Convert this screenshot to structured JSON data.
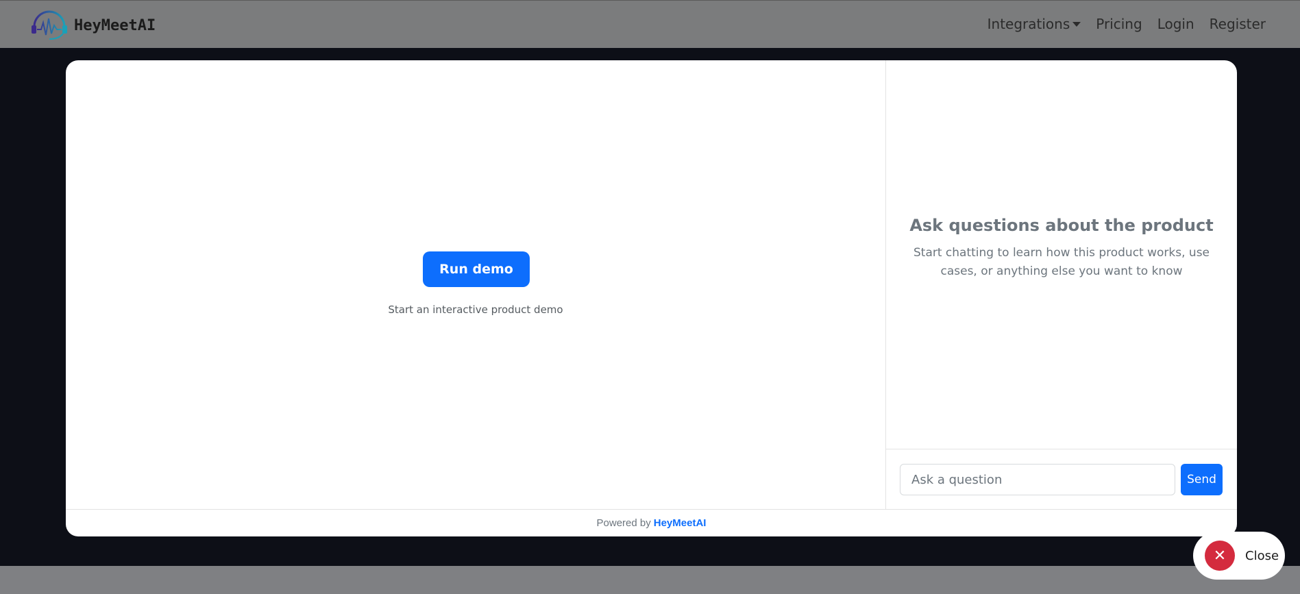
{
  "navbar": {
    "brand_name": "HeyMeetAI",
    "links": {
      "integrations": "Integrations",
      "pricing": "Pricing",
      "login": "Login",
      "register": "Register"
    }
  },
  "demo": {
    "run_button": "Run demo",
    "caption": "Start an interactive product demo"
  },
  "chat": {
    "title": "Ask questions about the product",
    "subtitle": "Start chatting to learn how this product works, use cases, or anything else you want to know",
    "input_placeholder": "Ask a question",
    "input_value": "",
    "send_label": "Send"
  },
  "footer": {
    "powered_prefix": "Powered by",
    "powered_brand": "HeyMeetAI"
  },
  "close_button": {
    "label": "Close",
    "icon": "close-icon"
  },
  "colors": {
    "accent": "#0d6efd",
    "close": "#d42b3e",
    "backdrop": "#0d0f17"
  }
}
